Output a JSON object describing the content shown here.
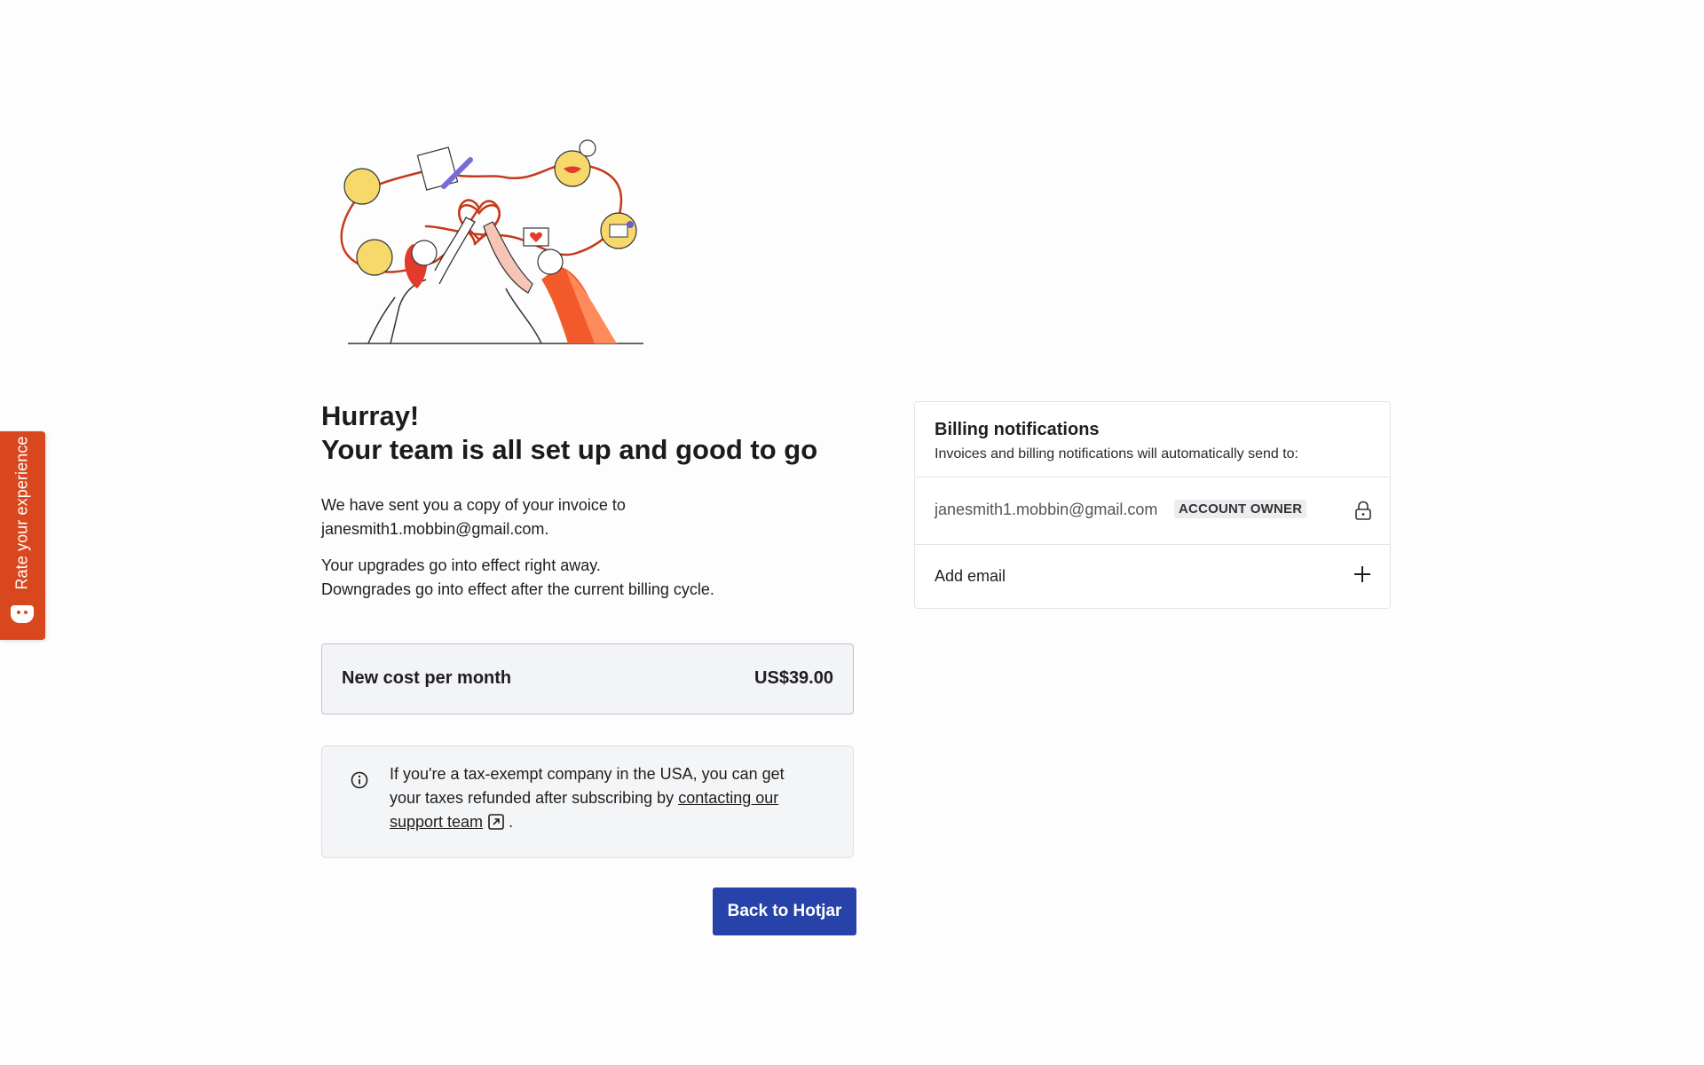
{
  "feedback_tab": {
    "label": "Rate your experience",
    "icon": "smiley-face-icon",
    "color": "#d9471f"
  },
  "illustration": {
    "icon": "team-high-five-illustration"
  },
  "main": {
    "headline_line1": "Hurray!",
    "headline_line2": "Your team is all set up and good to go",
    "invoice_text": "We have sent you a copy of your invoice to janesmith1.mobbin@gmail.com.",
    "upgrades_line": "Your upgrades go into effect right away.",
    "downgrades_line": "Downgrades go into effect after the current billing cycle.",
    "cost_label": "New cost per month",
    "cost_value": "US$39.00",
    "info_text_before_link": "If you're a tax-exempt company in the USA, you can get your taxes refunded after subscribing by ",
    "info_link_text": "contacting our support team",
    "info_text_after_link": " .",
    "info_icon": "info-circle-icon",
    "external_link_icon": "external-link-icon",
    "back_button_label": "Back to Hotjar",
    "back_button_color": "#2742a8"
  },
  "billing": {
    "title": "Billing notifications",
    "subtitle": "Invoices and billing notifications will automatically send to:",
    "email": "janesmith1.mobbin@gmail.com",
    "owner_badge": "ACCOUNT OWNER",
    "lock_icon": "lock-icon",
    "add_email_label": "Add email",
    "plus_icon": "plus-icon"
  }
}
